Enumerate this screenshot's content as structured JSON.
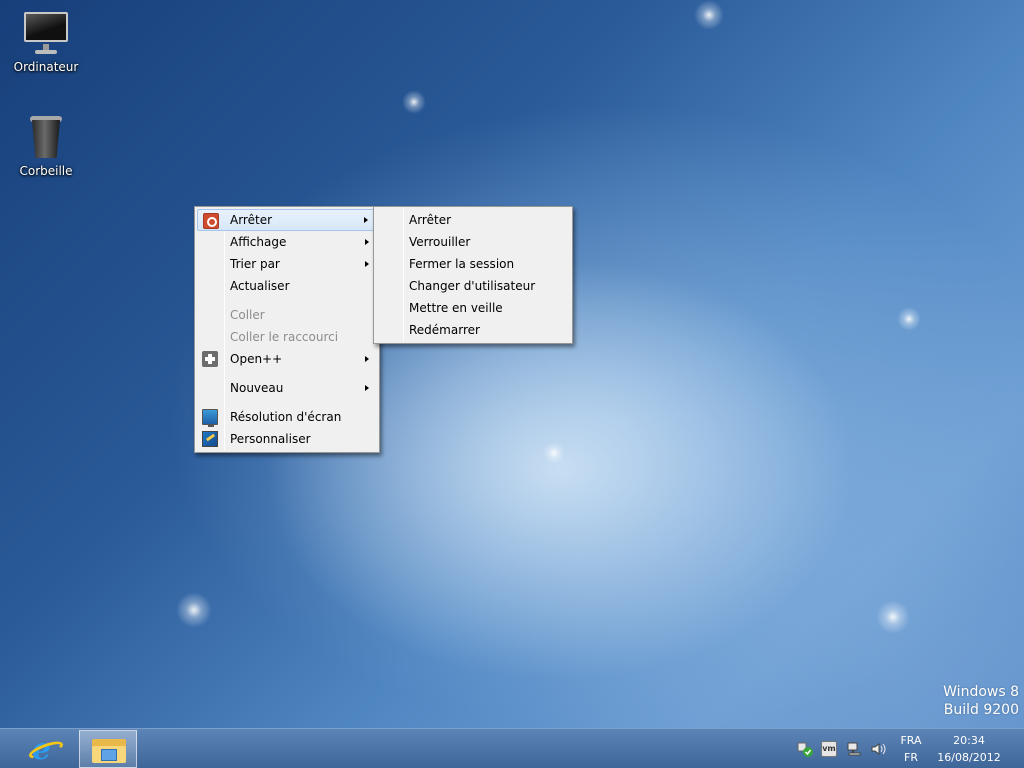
{
  "desktop": {
    "icons": [
      {
        "label": "Ordinateur",
        "icon": "computer-icon"
      },
      {
        "label": "Corbeille",
        "icon": "recycle-bin-icon"
      }
    ],
    "watermark": {
      "line1": "Windows 8",
      "line2": "Build 9200"
    }
  },
  "context_menu": {
    "items": [
      {
        "label": "Arrêter",
        "icon": "power-icon",
        "submenu": true,
        "highlighted": true
      },
      {
        "label": "Affichage",
        "submenu": true
      },
      {
        "label": "Trier par",
        "submenu": true
      },
      {
        "label": "Actualiser"
      },
      {
        "label": "Coller",
        "disabled": true
      },
      {
        "label": "Coller le raccourci",
        "disabled": true
      },
      {
        "label": "Open++",
        "icon": "open-plus-icon",
        "submenu": true
      },
      {
        "label": "Nouveau",
        "submenu": true
      },
      {
        "label": "Résolution d'écran",
        "icon": "display-icon"
      },
      {
        "label": "Personnaliser",
        "icon": "personalize-icon"
      }
    ]
  },
  "shutdown_submenu": {
    "items": [
      {
        "label": "Arrêter"
      },
      {
        "label": "Verrouiller"
      },
      {
        "label": "Fermer la session"
      },
      {
        "label": "Changer d'utilisateur"
      },
      {
        "label": "Mettre en veille"
      },
      {
        "label": "Redémarrer"
      }
    ]
  },
  "taskbar": {
    "pinned": [
      {
        "name": "internet-explorer",
        "icon": "internet-explorer-icon"
      },
      {
        "name": "file-explorer",
        "icon": "folder-icon",
        "active": true
      }
    ],
    "tray": {
      "icons": [
        "action-center-icon",
        "vmware-tools-icon",
        "network-icon",
        "volume-icon"
      ],
      "vmware_text": "vm",
      "language": "FRA",
      "keyboard": "FR",
      "time": "20:34",
      "date": "16/08/2012"
    }
  }
}
